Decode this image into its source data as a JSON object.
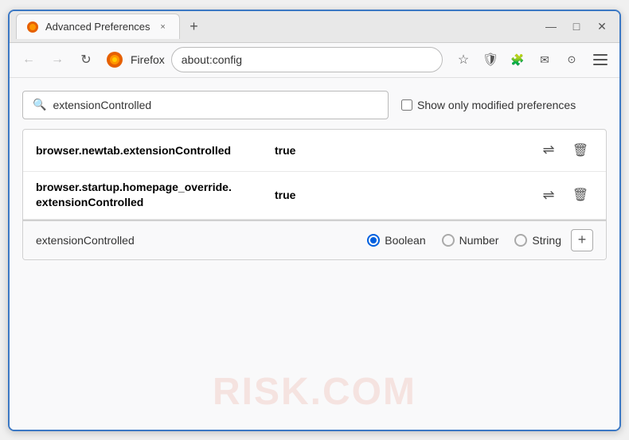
{
  "window": {
    "title": "Advanced Preferences",
    "tab_close_label": "×",
    "new_tab_label": "+",
    "minimize": "—",
    "maximize": "□",
    "close": "✕"
  },
  "nav": {
    "back_label": "←",
    "forward_label": "→",
    "reload_label": "↻",
    "firefox_label": "Firefox",
    "url": "about:config",
    "bookmark_icon": "☆",
    "shield_icon": "🛡",
    "extension_icon": "🧩",
    "email_icon": "✉",
    "cloud_icon": "⊙",
    "menu_lines": 3
  },
  "content": {
    "search": {
      "placeholder": "extensionControlled",
      "value": "extensionControlled"
    },
    "show_modified_label": "Show only modified preferences",
    "watermark": "RISK.COM",
    "preferences": [
      {
        "name": "browser.newtab.extensionControlled",
        "value": "true"
      },
      {
        "name_line1": "browser.startup.homepage_override.",
        "name_line2": "extensionControlled",
        "value": "true"
      }
    ],
    "new_pref": {
      "name": "extensionControlled",
      "types": [
        {
          "label": "Boolean",
          "selected": true
        },
        {
          "label": "Number",
          "selected": false
        },
        {
          "label": "String",
          "selected": false
        }
      ],
      "add_label": "+"
    }
  }
}
